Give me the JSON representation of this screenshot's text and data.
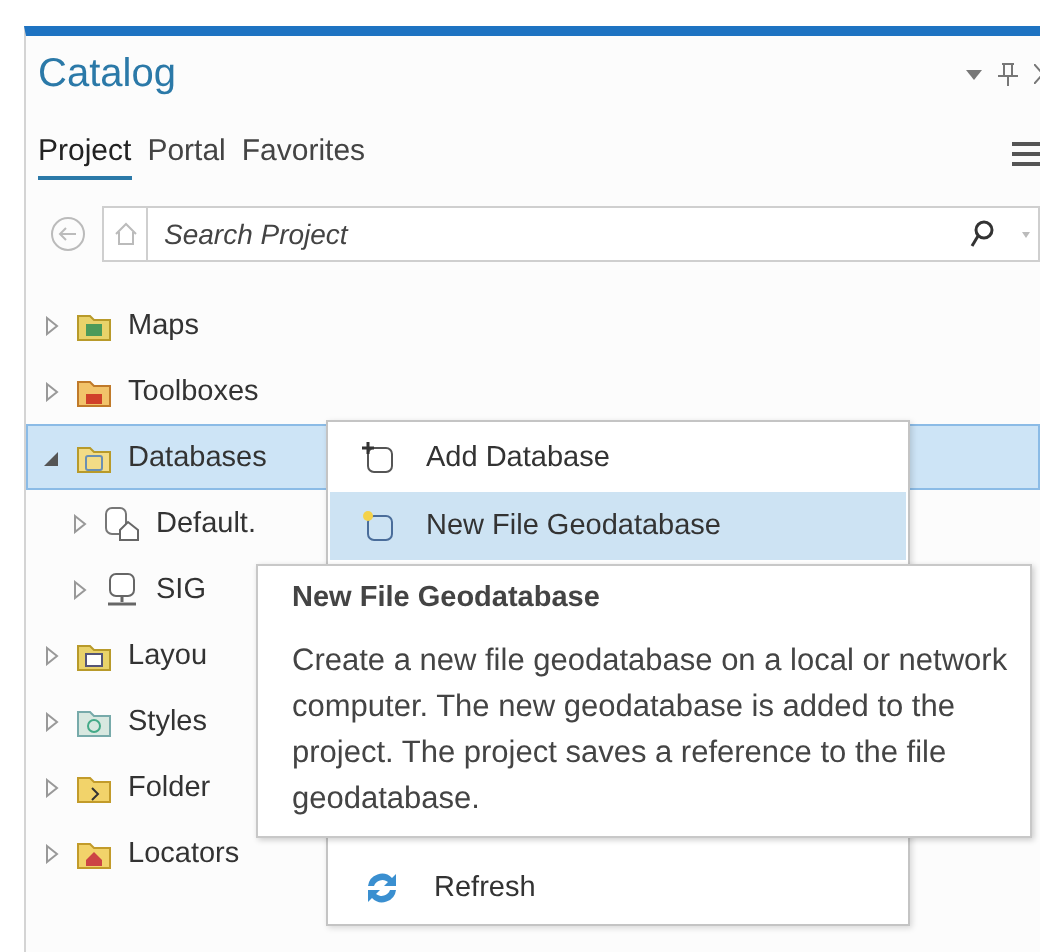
{
  "panel": {
    "title": "Catalog"
  },
  "tabs": [
    {
      "label": "Project",
      "selected": true
    },
    {
      "label": "Portal",
      "selected": false
    },
    {
      "label": "Favorites",
      "selected": false
    }
  ],
  "search": {
    "placeholder": "Search Project"
  },
  "tree": {
    "items": [
      {
        "label": "Maps",
        "kind": "maps",
        "expanded": false,
        "selected": false
      },
      {
        "label": "Toolboxes",
        "kind": "toolboxes",
        "expanded": false,
        "selected": false
      },
      {
        "label": "Databases",
        "kind": "databases",
        "expanded": true,
        "selected": true,
        "children": [
          {
            "label": "Default.",
            "kind": "geodatabase",
            "expanded": false,
            "selected": false
          },
          {
            "label": "SIG",
            "kind": "connection",
            "expanded": false,
            "selected": false
          }
        ]
      },
      {
        "label": "Layou",
        "kind": "layouts",
        "expanded": false,
        "selected": false
      },
      {
        "label": "Styles",
        "kind": "styles",
        "expanded": false,
        "selected": false
      },
      {
        "label": "Folder",
        "kind": "folders",
        "expanded": false,
        "selected": false
      },
      {
        "label": "Locators",
        "kind": "locators",
        "expanded": false,
        "selected": false
      }
    ]
  },
  "context_menu": {
    "groups": [
      [
        {
          "label": "Add Database",
          "kind": "add",
          "selected": false
        },
        {
          "label": "New File Geodatabase",
          "kind": "new",
          "selected": true
        }
      ],
      [
        {
          "label": "Refresh",
          "kind": "refresh",
          "selected": false
        }
      ]
    ]
  },
  "tooltip": {
    "title": "New File Geodatabase",
    "text": "Create a new file geodatabase on a local or network computer. The new geodatabase is added to the project. The project saves a reference to the file geodatabase."
  }
}
